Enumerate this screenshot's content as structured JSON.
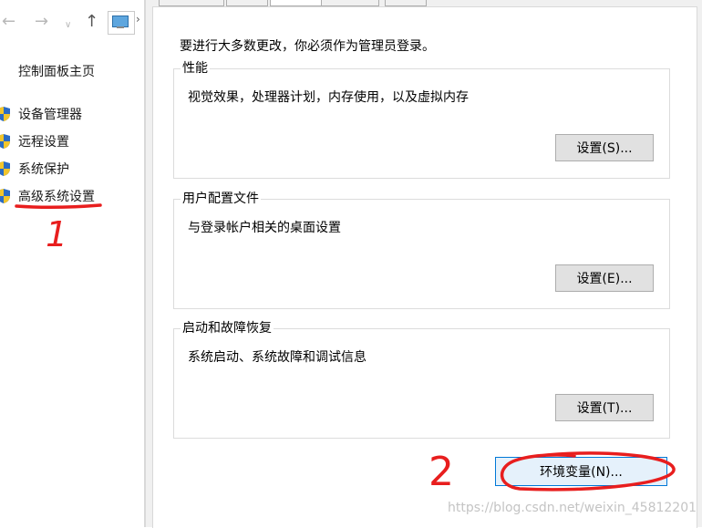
{
  "explorer": {
    "back_icon": "back-arrow-icon",
    "forward_icon": "forward-arrow-icon",
    "history_icon": "chevron-down-icon",
    "up_icon": "up-arrow-icon",
    "location_icon": "computer-icon",
    "home_link": "控制面板主页",
    "nav_items": [
      {
        "label": "设备管理器",
        "icon": "uac-shield-icon"
      },
      {
        "label": "远程设置",
        "icon": "uac-shield-icon"
      },
      {
        "label": "系统保护",
        "icon": "uac-shield-icon"
      },
      {
        "label": "高级系统设置",
        "icon": "uac-shield-icon"
      }
    ]
  },
  "dialog": {
    "admin_note": "要进行大多数更改，你必须作为管理员登录。",
    "groups": [
      {
        "title": "性能",
        "description": "视觉效果，处理器计划，内存使用，以及虚拟内存",
        "button": "设置(S)..."
      },
      {
        "title": "用户配置文件",
        "description": "与登录帐户相关的桌面设置",
        "button": "设置(E)..."
      },
      {
        "title": "启动和故障恢复",
        "description": "系统启动、系统故障和调试信息",
        "button": "设置(T)..."
      }
    ],
    "env_button": "环境变量(N)..."
  },
  "annotations": {
    "step1": "1",
    "step2": "2",
    "color": "#e81e1e"
  },
  "watermark": "https://blog.csdn.net/weixin_45812201"
}
